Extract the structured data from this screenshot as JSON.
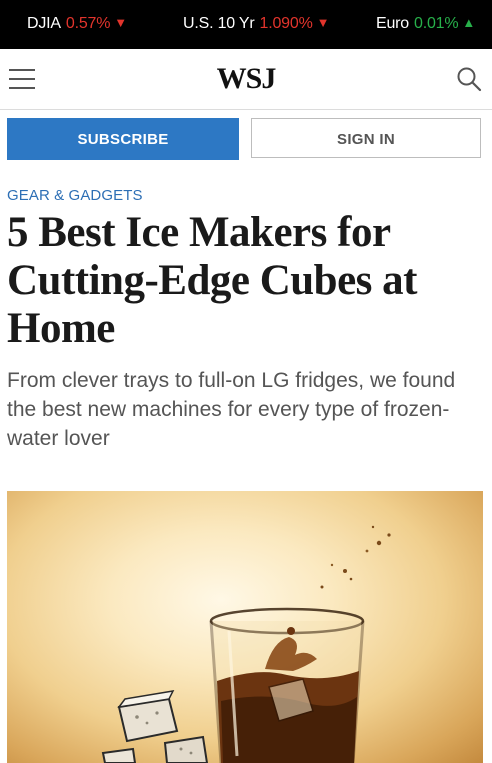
{
  "ticker": [
    {
      "name": "DJIA",
      "value": "0.57%",
      "direction": "down"
    },
    {
      "name": "U.S. 10 Yr",
      "value": "1.090%",
      "direction": "down"
    },
    {
      "name": "Euro",
      "value": "0.01%",
      "direction": "up"
    }
  ],
  "header": {
    "logo": "WSJ",
    "menu_icon": "hamburger-menu-icon",
    "search_icon": "search-icon"
  },
  "auth": {
    "subscribe_label": "SUBSCRIBE",
    "signin_label": "SIGN IN"
  },
  "article": {
    "section": "GEAR & GADGETS",
    "headline": "5 Best Ice Makers for Cutting-Edge Cubes at Home",
    "dek": "From clever trays to full-on LG fridges, we found the best new machines for every type of frozen-water lover"
  },
  "colors": {
    "ticker_bg": "#000000",
    "negative": "#e2342c",
    "positive": "#27b04a",
    "subscribe_bg": "#2d78c4",
    "section_label": "#2d6fb5"
  }
}
